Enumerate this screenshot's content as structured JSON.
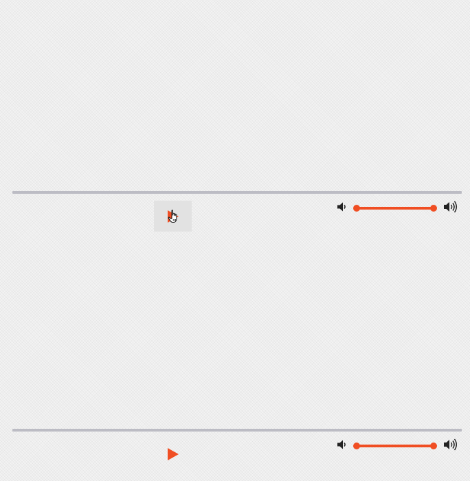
{
  "colors": {
    "accent": "#f04e23",
    "track": "#bcbcc4",
    "icon": "#222222",
    "hover_bg": "#e2e2e2"
  },
  "players": [
    {
      "state": "paused",
      "play_button": {
        "icon": "play-icon",
        "hovered": true
      },
      "progress": 0,
      "volume": {
        "icon_low": "volume-low-icon",
        "icon_high": "volume-high-icon",
        "level": 1.0
      }
    },
    {
      "state": "paused",
      "play_button": {
        "icon": "play-icon",
        "hovered": false
      },
      "progress": 0,
      "volume": {
        "icon_low": "volume-low-icon",
        "icon_high": "volume-high-icon",
        "level": 1.0
      }
    }
  ]
}
